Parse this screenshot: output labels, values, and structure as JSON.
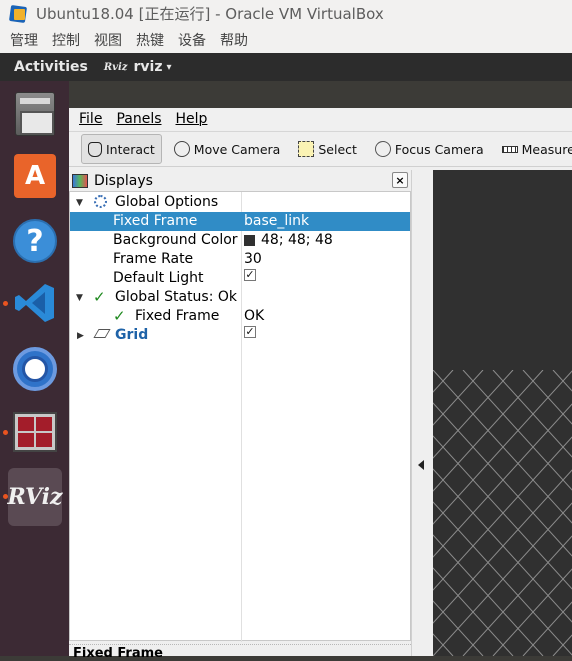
{
  "vbox": {
    "title": "Ubuntu18.04 [正在运行] - Oracle VM VirtualBox",
    "menu": [
      "管理",
      "控制",
      "视图",
      "热键",
      "设备",
      "帮助"
    ]
  },
  "topbar": {
    "activities": "Activities",
    "app_badge": "Rviz",
    "app_name": "rviz",
    "caret": "▾"
  },
  "dock": {
    "items": [
      "files-icon",
      "ubuntu-software-icon",
      "help-icon",
      "vscode-icon",
      "chromium-icon",
      "terminator-icon",
      "rviz-icon"
    ],
    "rviz_logo_text": "RViz",
    "software_glyph": "A",
    "help_glyph": "?"
  },
  "rviz": {
    "menu": {
      "file": "File",
      "panels": "Panels",
      "help": "Help"
    },
    "tools": {
      "interact": "Interact",
      "move_camera": "Move Camera",
      "select": "Select",
      "focus_camera": "Focus Camera",
      "measure": "Measure"
    },
    "displays": {
      "title": "Displays",
      "close": "×",
      "global_options": "Global Options",
      "fixed_frame_label": "Fixed Frame",
      "fixed_frame_value": "base_link",
      "bg_color_label": "Background Color",
      "bg_color_value": "48; 48; 48",
      "bg_color_hex": "#303030",
      "frame_rate_label": "Frame Rate",
      "frame_rate_value": "30",
      "default_light_label": "Default Light",
      "default_light_checked": "✓",
      "global_status": "Global Status: Ok",
      "status_fixed_frame": "Fixed Frame",
      "status_fixed_frame_value": "OK",
      "grid": "Grid",
      "grid_checked": "✓"
    },
    "bottom_panel_title": "Fixed Frame"
  },
  "colors": {
    "selection": "#308cc6",
    "status_ok": "#1f8a1f",
    "dock_bg": "#3c2a34",
    "ubuntu_orange": "#e95420"
  }
}
